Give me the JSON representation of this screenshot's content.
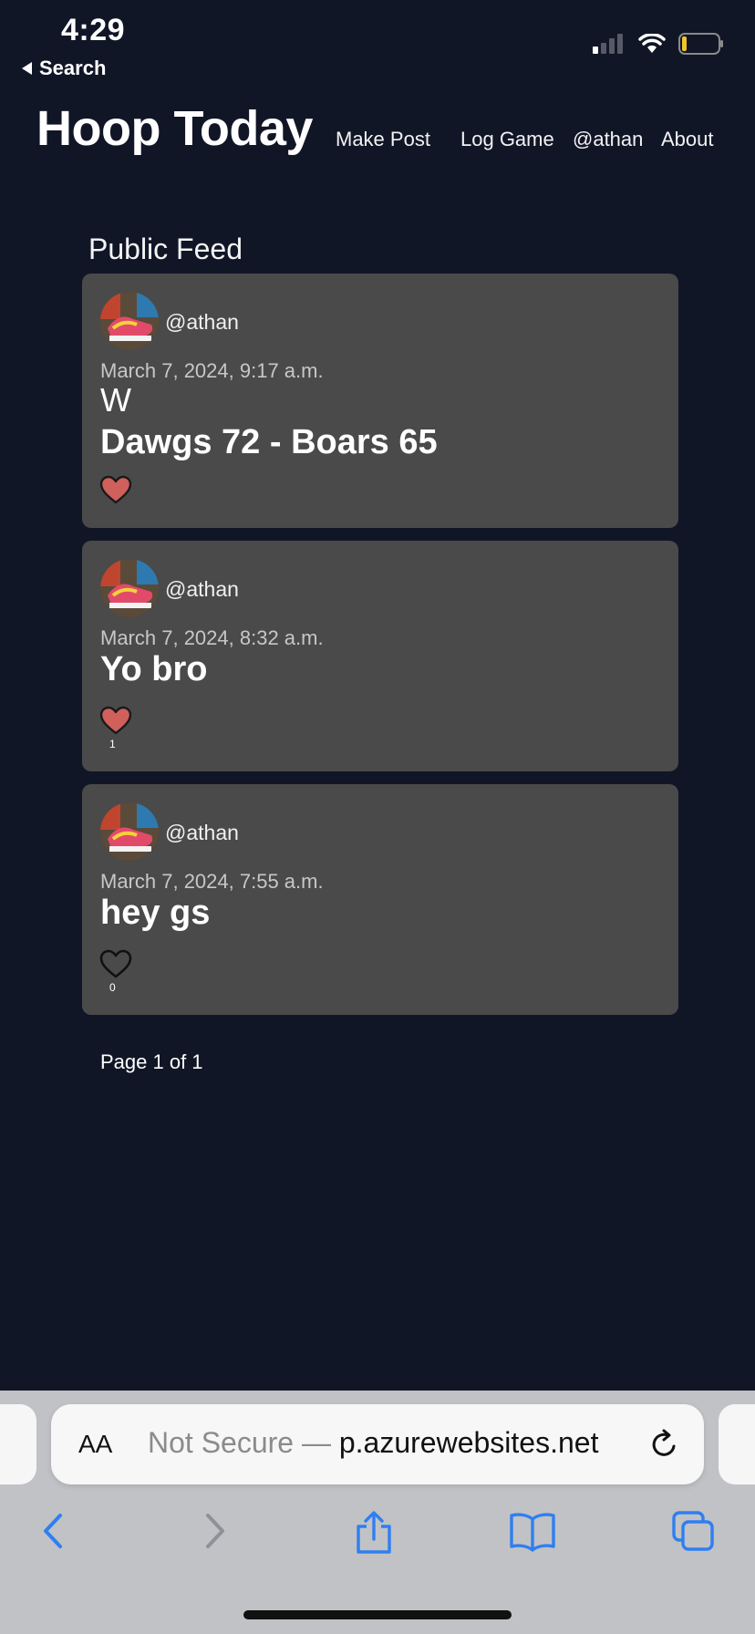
{
  "status_bar": {
    "time": "4:29",
    "back_label": "Search"
  },
  "header": {
    "title": "Hoop Today",
    "nav": [
      "Make Post",
      "Log Game",
      "@athan",
      "About"
    ]
  },
  "feed": {
    "title": "Public Feed",
    "posts": [
      {
        "username": "@athan",
        "date": "March 7, 2024, 9:17 a.m.",
        "title": "W",
        "body": "Dawgs 72 - Boars 65",
        "liked": true,
        "likes": ""
      },
      {
        "username": "@athan",
        "date": "March 7, 2024, 8:32 a.m.",
        "title": "",
        "body": "Yo bro",
        "liked": true,
        "likes": "1"
      },
      {
        "username": "@athan",
        "date": "March 7, 2024, 7:55 a.m.",
        "title": "",
        "body": "hey gs",
        "liked": false,
        "likes": "0"
      }
    ],
    "pagination": "Page 1 of 1"
  },
  "browser": {
    "text_size_label": "AA",
    "security_label": "Not Secure — ",
    "url": "p.azurewebsites.net"
  },
  "colors": {
    "background": "#111627",
    "card": "#4a4a4a",
    "heart_liked": "#d0605c",
    "browser_blue": "#2f7ff0"
  }
}
